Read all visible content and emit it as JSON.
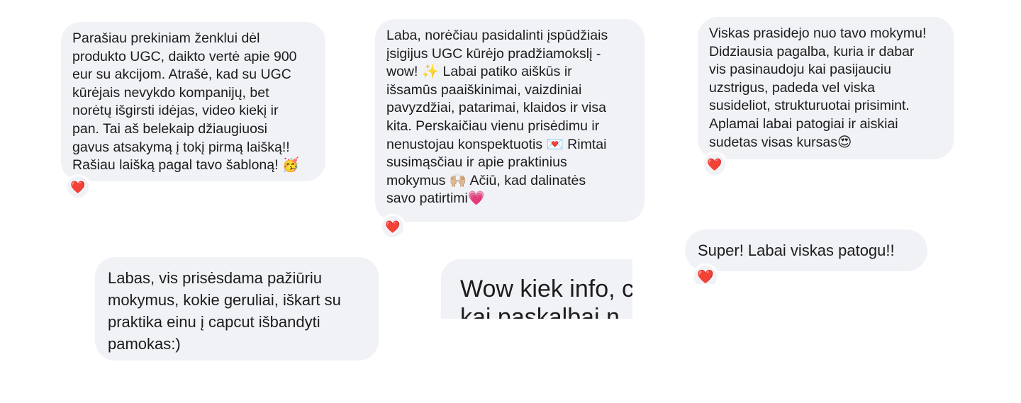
{
  "messages": [
    {
      "text": "Parašiau prekiniam ženklui dėl\nprodukto UGC, daikto vertė apie 900\neur su akcijom. Atrašė, kad su UGC\nkūrėjais nevykdo kompanijų, bet\nnorėtų išgirsti idėjas, video kiekį ir\npan. Tai aš belekaip džiaugiuosi\ngavus atsakymą į tokį pirmą laišką!!\nRašiau laišką pagal tavo šabloną! 🥳",
      "reaction": "❤️"
    },
    {
      "text": "Laba, norėčiau pasidalinti įspūdžiais\nįsigijus UGC kūrėjo pradžiamokslį -\nwow! ✨ Labai patiko aiškūs ir\nišsamūs paaiškinimai, vaizdiniai\npavyzdžiai, patarimai, klaidos ir visa\nkita. Perskaičiau vienu prisėdimu ir\nnenustojau konspektuotis 💌 Rimtai\nsusimąsčiau ir apie praktinius\nmokymus 🙌🏼 Ačiū, kad dalinatės\nsavo patirtimi💗",
      "reaction": "❤️"
    },
    {
      "text": "Viskas prasidejo nuo tavo mokymu!\nDidziausia pagalba, kuria ir dabar\nvis pasinaudoju kai pasijauciu\nuzstrigus, padeda vel viska\nsusideliot, strukturuotai prisimint.\nAplamai labai patogiai ir aiskiai\nsudetas visas kursas😍",
      "reaction": "❤️"
    },
    {
      "text": "Labas, vis prisėsdama pažiūriu\nmokymus, kokie geruliai, iškart su\npraktika einu į capcut išbandyti\npamokas:)"
    },
    {
      "text": "Wow kiek info, c\nkai paskalbai n"
    },
    {
      "text": "Super! Labai viskas patogu!!",
      "reaction": "❤️"
    }
  ]
}
